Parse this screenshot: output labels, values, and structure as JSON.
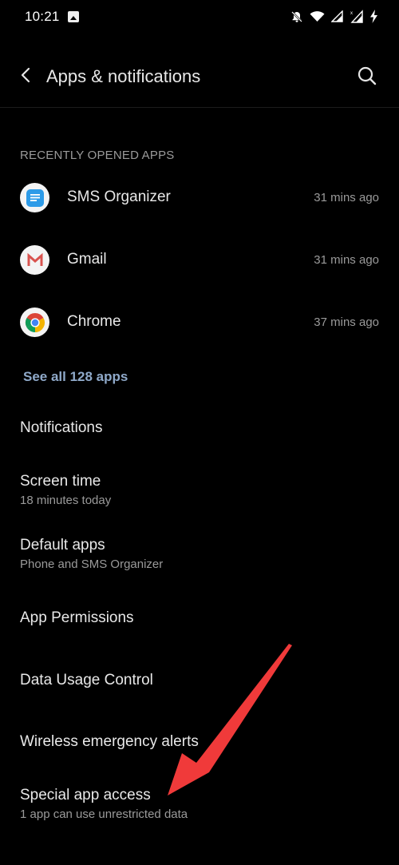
{
  "status_bar": {
    "time": "10:21",
    "icons": [
      "image-notification-icon",
      "bell-off-icon",
      "wifi-icon",
      "signal-icon",
      "signal-no-data-icon",
      "charging-icon"
    ]
  },
  "header": {
    "title": "Apps & notifications",
    "back_icon": "chevron-left-icon",
    "search_icon": "search-icon"
  },
  "recent_apps": {
    "section_label": "RECENTLY OPENED APPS",
    "items": [
      {
        "name": "SMS Organizer",
        "time": "31 mins ago",
        "icon": "sms-organizer-icon"
      },
      {
        "name": "Gmail",
        "time": "31 mins ago",
        "icon": "gmail-icon"
      },
      {
        "name": "Chrome",
        "time": "37 mins ago",
        "icon": "chrome-icon"
      }
    ],
    "see_all_label": "See all 128 apps"
  },
  "settings_items": [
    {
      "title": "Notifications",
      "subtitle": ""
    },
    {
      "title": "Screen time",
      "subtitle": "18 minutes today"
    },
    {
      "title": "Default apps",
      "subtitle": "Phone and SMS Organizer"
    },
    {
      "title": "App Permissions",
      "subtitle": ""
    },
    {
      "title": "Data Usage Control",
      "subtitle": ""
    },
    {
      "title": "Wireless emergency alerts",
      "subtitle": ""
    },
    {
      "title": "Special app access",
      "subtitle": "1 app can use unrestricted data"
    }
  ],
  "annotation": {
    "type": "red-arrow",
    "points_to": "Special app access",
    "color": "#f03a3a"
  },
  "colors": {
    "background": "#000000",
    "link": "#8fa9c9",
    "secondary_text": "#9a9a9a",
    "primary_text": "#e8e8e8"
  }
}
